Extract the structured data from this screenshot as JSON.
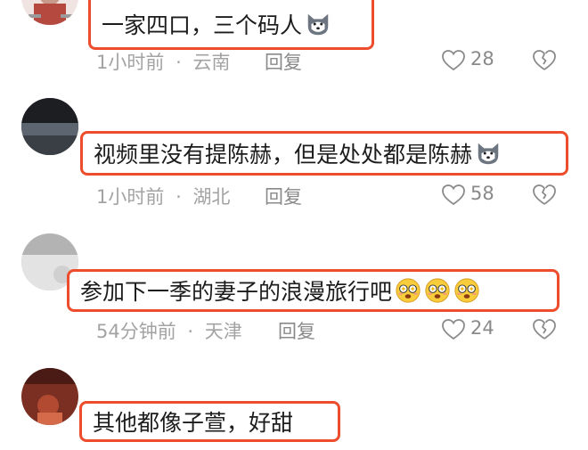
{
  "comments": [
    {
      "text": "一家四口，三个码人",
      "emojis": [
        "husky-emoji"
      ],
      "time": "1小时前",
      "separator": "·",
      "location": "云南",
      "reply_label": "回复",
      "likes": "28"
    },
    {
      "text": "视频里没有提陈赫，但是处处都是陈赫",
      "emojis": [
        "husky-emoji"
      ],
      "time": "1小时前",
      "separator": "·",
      "location": "湖北",
      "reply_label": "回复",
      "likes": "58"
    },
    {
      "text": "参加下一季的妻子的浪漫旅行吧",
      "emojis": [
        "starry-eyes-emoji",
        "starry-eyes-emoji",
        "starry-eyes-emoji"
      ],
      "time": "54分钟前",
      "separator": "·",
      "location": "天津",
      "reply_label": "回复",
      "likes": "24"
    },
    {
      "text": "其他都像子萱，好甜",
      "emojis": []
    }
  ],
  "colors": {
    "highlight_border": "#ee4d2d",
    "meta_text": "#a3a3a3",
    "comment_text": "#1c1c1c"
  }
}
